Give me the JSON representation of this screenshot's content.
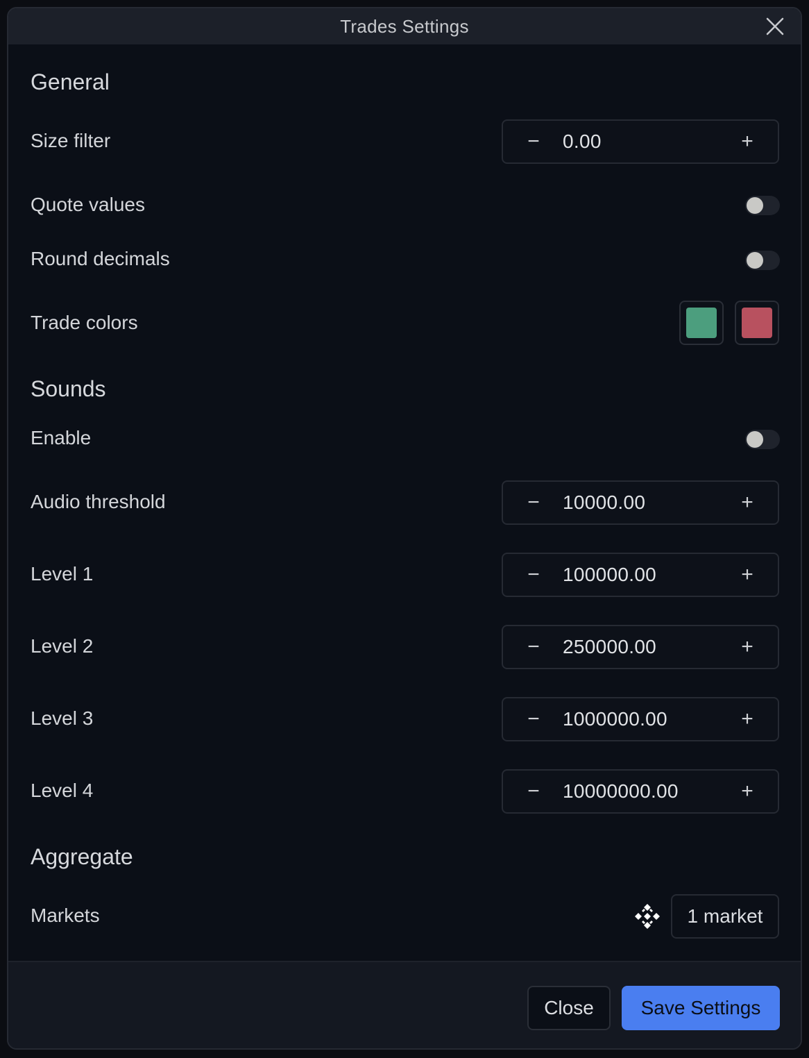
{
  "window": {
    "title": "Trades Settings"
  },
  "general": {
    "heading": "General",
    "size_filter": {
      "label": "Size filter",
      "value": "0.00",
      "minus": "−",
      "plus": "+"
    },
    "quote_values": {
      "label": "Quote values",
      "enabled": false
    },
    "round_decimals": {
      "label": "Round decimals",
      "enabled": false
    },
    "trade_colors": {
      "label": "Trade colors",
      "buy_color": "#4c9e7e",
      "sell_color": "#b8515f"
    }
  },
  "sounds": {
    "heading": "Sounds",
    "enable": {
      "label": "Enable",
      "enabled": false
    },
    "audio_threshold": {
      "label": "Audio threshold",
      "value": "10000.00",
      "minus": "−",
      "plus": "+"
    },
    "level1": {
      "label": "Level 1",
      "value": "100000.00",
      "minus": "−",
      "plus": "+"
    },
    "level2": {
      "label": "Level 2",
      "value": "250000.00",
      "minus": "−",
      "plus": "+"
    },
    "level3": {
      "label": "Level 3",
      "value": "1000000.00",
      "minus": "−",
      "plus": "+"
    },
    "level4": {
      "label": "Level 4",
      "value": "10000000.00",
      "minus": "−",
      "plus": "+"
    }
  },
  "aggregate": {
    "heading": "Aggregate",
    "markets": {
      "label": "Markets",
      "icon": "exchange-logo-icon",
      "button_label": "1 market"
    }
  },
  "footer": {
    "close_label": "Close",
    "save_label": "Save Settings"
  },
  "colors": {
    "accent": "#4a7ef0"
  }
}
